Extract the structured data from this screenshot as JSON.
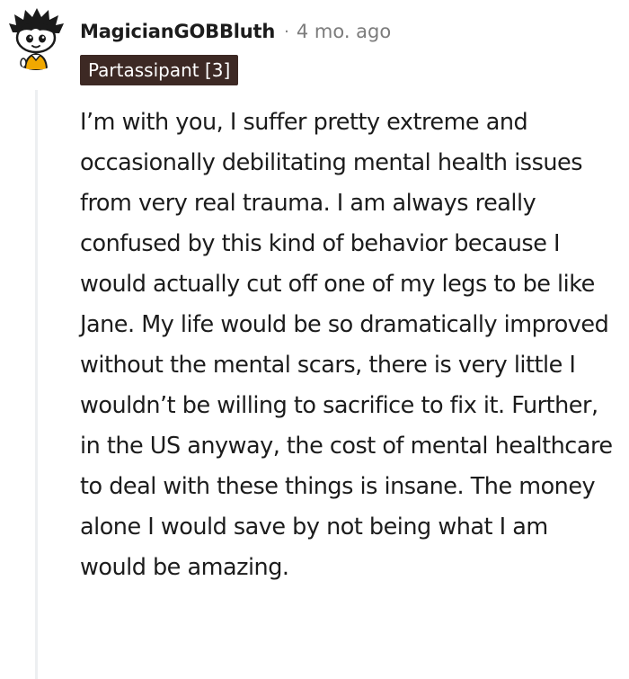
{
  "comment": {
    "author": "MagicianGOBBluth",
    "separator": "·",
    "timestamp": "4 mo. ago",
    "flair": "Partassipant [3]",
    "body": "I’m with you, I suffer pretty extreme and occasionally debilitating mental health issues from very real trauma. I am always really confused by this kind of behavior because I would actually cut off one of my legs to be like Jane. My life would be so dramatically improved without the mental scars, there is very little I wouldn’t be willing to sacrifice to fix it. Further, in the US anyway, the cost of mental healthcare to deal with these things is insane. The money alone I would save by not being what I am would be amazing.",
    "avatar_icon": "snoo-avatar-icon"
  },
  "colors": {
    "flair_bg": "#3d2924",
    "flair_text": "#ffffff",
    "meta_text": "#7c7c7c",
    "body_text": "#1c1c1c",
    "thread_line": "#edeff1",
    "avatar_shirt": "#f0a800"
  }
}
